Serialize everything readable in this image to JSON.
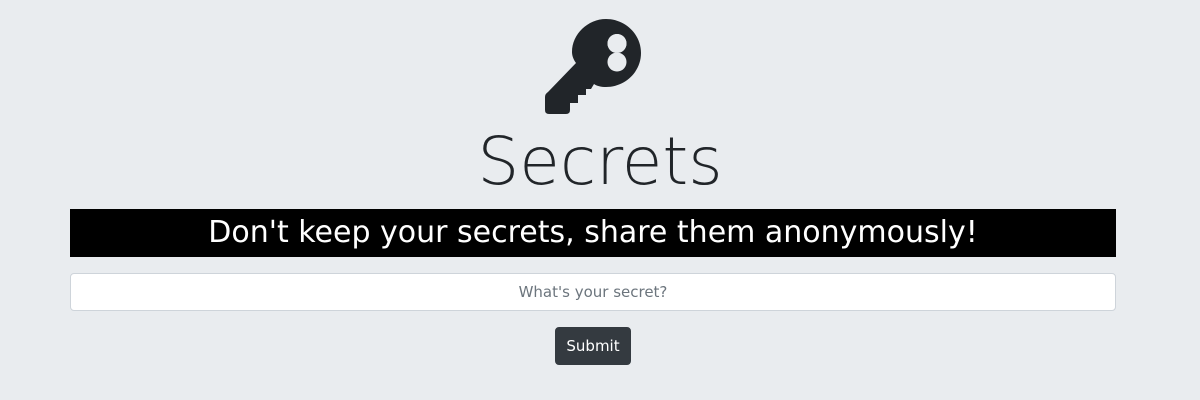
{
  "header": {
    "icon": "key-icon",
    "title": "Secrets",
    "tagline": "Don't keep your secrets, share them anonymously!"
  },
  "form": {
    "secret_placeholder": "What's your secret?",
    "secret_value": "",
    "submit_label": "Submit"
  },
  "colors": {
    "background": "#e9ecef",
    "icon": "#212529",
    "tagline_bg": "#000000",
    "tagline_text": "#ffffff",
    "button_bg": "#343a40",
    "button_text": "#ffffff"
  }
}
